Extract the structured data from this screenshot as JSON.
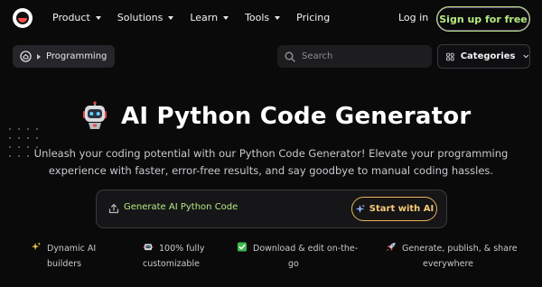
{
  "nav": {
    "menu": [
      {
        "label": "Product",
        "dropdown": true
      },
      {
        "label": "Solutions",
        "dropdown": true
      },
      {
        "label": "Learn",
        "dropdown": true
      },
      {
        "label": "Tools",
        "dropdown": true
      },
      {
        "label": "Pricing",
        "dropdown": false
      }
    ],
    "login_label": "Log in",
    "signup_label": "Sign up for free"
  },
  "breadcrumb": {
    "current": "Programming"
  },
  "search": {
    "placeholder": "Search"
  },
  "categories_label": "Categories",
  "hero": {
    "title": "AI Python Code Generator",
    "subtitle_lines": [
      "Unleash your coding potential with our Python Code Generator! Elevate your programming",
      "experience with faster, error-free results, and say goodbye to manual coding hassles."
    ]
  },
  "prompt": {
    "placeholder": "Generate AI Python Code",
    "start_label": "Start with AI"
  },
  "features": [
    {
      "icon": "sparkles-icon",
      "lines": [
        "Dynamic AI",
        "builders"
      ]
    },
    {
      "icon": "robot-icon",
      "lines": [
        "100% fully",
        "customizable"
      ]
    },
    {
      "icon": "check-icon",
      "lines": [
        "Download & edit on-the-",
        "go"
      ]
    },
    {
      "icon": "rocket-icon",
      "lines": [
        "Generate, publish, & share",
        "everywhere"
      ]
    }
  ],
  "colors": {
    "accent_green": "#b6ea82",
    "accent_gold": "#f5c97a",
    "background": "#0a0a0b"
  }
}
